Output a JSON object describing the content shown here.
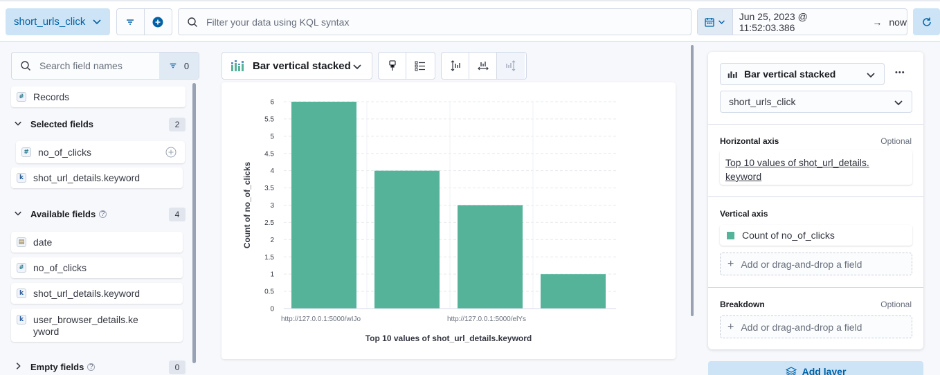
{
  "topbar": {
    "data_view": "short_urls_click",
    "kql_placeholder": "Filter your data using KQL syntax",
    "date_start": "Jun 25, 2023 @ 11:52:03.386",
    "date_arrow": "→",
    "date_end": "now"
  },
  "fields_panel": {
    "search_placeholder": "Search field names",
    "filter_count": "0",
    "records_label": "Records",
    "selected": {
      "title": "Selected fields",
      "count": "2",
      "items": [
        {
          "name": "no_of_clicks",
          "type": "#"
        },
        {
          "name": "shot_url_details.keyword",
          "type": "k"
        }
      ]
    },
    "available": {
      "title": "Available fields",
      "count": "4",
      "items": [
        {
          "name": "date",
          "type": "date"
        },
        {
          "name": "no_of_clicks",
          "type": "#"
        },
        {
          "name": "shot_url_details.keyword",
          "type": "k"
        },
        {
          "name": "user_browser_details.ke",
          "name_line2": "yword",
          "type": "k"
        }
      ]
    },
    "empty": {
      "title": "Empty fields",
      "count": "0"
    }
  },
  "workspace": {
    "chart_type_label": "Bar vertical stacked"
  },
  "chart_data": {
    "type": "bar",
    "categories": [
      "http://127.0.0.1:5000/wIJo",
      "",
      "http://127.0.0.1:5000/elYs",
      ""
    ],
    "values": [
      6,
      4,
      3,
      1
    ],
    "xlabel": "Top 10 values of shot_url_details.keyword",
    "ylabel": "Count of no_of_clicks",
    "ylim": [
      0,
      6
    ],
    "yticks": [
      "0",
      "0.5",
      "1",
      "1.5",
      "2",
      "2.5",
      "3",
      "3.5",
      "4",
      "4.5",
      "5",
      "5.5",
      "6"
    ],
    "bar_color": "#54b399",
    "grid": true
  },
  "config_panel": {
    "chart_type": "Bar vertical stacked",
    "more": "•••",
    "data_view": "short_urls_click",
    "horizontal_axis": {
      "label": "Horizontal axis",
      "optional": "Optional",
      "value_line1": "Top 10 values of shot_url_details.",
      "value_line2": "keyword"
    },
    "vertical_axis": {
      "label": "Vertical axis",
      "value": "Count of no_of_clicks",
      "color": "#54b399",
      "add": "Add or drag-and-drop a field"
    },
    "breakdown": {
      "label": "Breakdown",
      "optional": "Optional",
      "add": "Add or drag-and-drop a field"
    },
    "add_layer": "Add layer"
  },
  "colors": {
    "primary": "#0061a6",
    "primary_light": "#cce4f5",
    "bar": "#54b399"
  }
}
